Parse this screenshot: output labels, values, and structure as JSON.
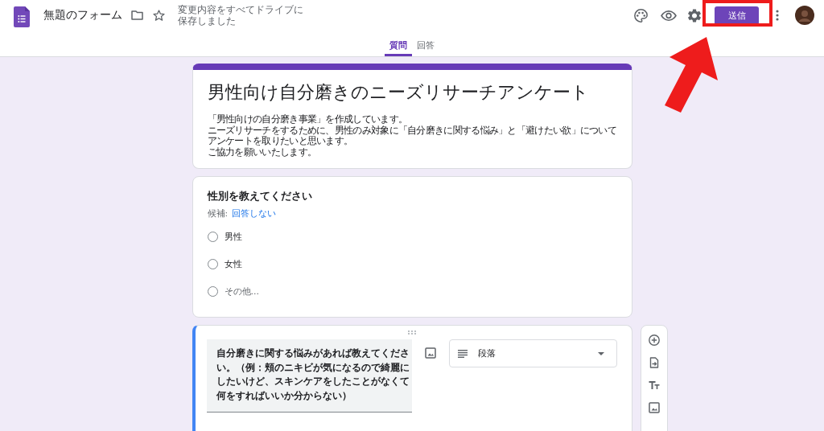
{
  "header": {
    "title": "無題のフォーム",
    "save_status": "変更内容をすべてドライブに保存しました",
    "send_button": "送信"
  },
  "tabs": [
    {
      "label": "質問",
      "selected": true
    },
    {
      "label": "回答",
      "selected": false
    }
  ],
  "form": {
    "title": "男性向け自分磨きのニーズリサーチアンケート",
    "description_lines": [
      "「男性向けの自分磨き事業」を作成しています。",
      "ニーズリサーチをするために、男性のみ対象に「自分磨きに関する悩み」と「避けたい欲」について",
      "アンケートを取りたいと思います。",
      "ご協力を願いいたします。"
    ]
  },
  "questions": [
    {
      "kind": "multiple_choice",
      "focused": false,
      "title": "性別を教えてください",
      "suggestion_label": "候補:",
      "suggestion": "回答しない",
      "options": [
        {
          "kind": "option",
          "label": "男性",
          "selected": false
        },
        {
          "kind": "option",
          "label": "女性",
          "selected": false
        },
        {
          "kind": "other",
          "label": "その他...",
          "selected": false
        }
      ]
    },
    {
      "kind": "editing",
      "focused": true,
      "title": "自分磨きに関する悩みがあれば教えてください。（例：頬のニキビが気になるので綺麗にしたいけど、スキンケアをしたことがなくて何をすればいいか分からない）",
      "type_label": "段落"
    }
  ]
}
